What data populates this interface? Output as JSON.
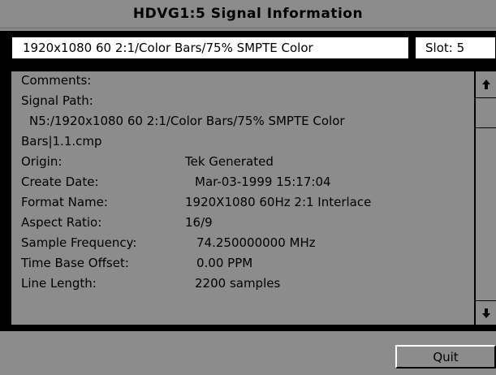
{
  "window": {
    "title": "HDVG1:5  Signal Information"
  },
  "signal": {
    "name": "1920x1080  60 2:1/Color Bars/75% SMPTE  Color",
    "slot": "Slot: 5"
  },
  "info": {
    "comments_label": "Comments:",
    "signal_path_label": "Signal Path:",
    "signal_path_line1": "N5:/1920x1080  60 2:1/Color Bars/75% SMPTE  Color",
    "signal_path_line2": "Bars|1.1.cmp",
    "rows": [
      {
        "label": "Origin:",
        "value": "Tek Generated"
      },
      {
        "label": "Create Date:",
        "value": "Mar-03-1999  15:17:04"
      },
      {
        "label": "Format Name:",
        "value": "1920X1080 60Hz 2:1 Interlace"
      },
      {
        "label": "Aspect Ratio:",
        "value": "16/9"
      },
      {
        "label": "Sample Frequency:",
        "value": "74.250000000 MHz"
      },
      {
        "label": "Time Base Offset:",
        "value": "0.00 PPM"
      },
      {
        "label": "Line Length:",
        "value": "2200 samples"
      }
    ]
  },
  "scrollbar": {
    "up_icon": "arrow-up",
    "down_icon": "arrow-down"
  },
  "footer": {
    "quit_label": "Quit"
  }
}
